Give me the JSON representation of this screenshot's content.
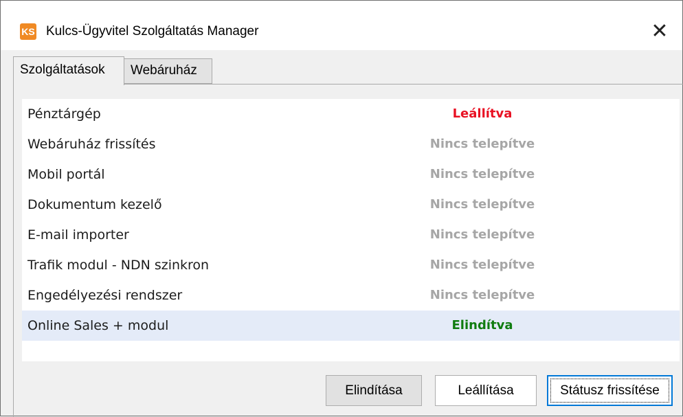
{
  "window": {
    "title": "Kulcs-Ügyvitel Szolgáltatás Manager",
    "icon_text": "KS",
    "close_glyph": "✕"
  },
  "tabs": [
    {
      "label": "Szolgáltatások",
      "active": true
    },
    {
      "label": "Webáruház",
      "active": false
    }
  ],
  "services": [
    {
      "name": "Pénztárgép",
      "status": "Leállítva",
      "status_color": "#e81123"
    },
    {
      "name": "Webáruház frissítés",
      "status": "Nincs telepítve",
      "status_color": "#a6a6a6"
    },
    {
      "name": "Mobil portál",
      "status": "Nincs telepítve",
      "status_color": "#a6a6a6"
    },
    {
      "name": "Dokumentum kezelő",
      "status": "Nincs telepítve",
      "status_color": "#a6a6a6"
    },
    {
      "name": "E-mail importer",
      "status": "Nincs telepítve",
      "status_color": "#a6a6a6"
    },
    {
      "name": "Trafik modul - NDN szinkron",
      "status": "Nincs telepítve",
      "status_color": "#a6a6a6"
    },
    {
      "name": "Engedélyezési rendszer",
      "status": "Nincs telepítve",
      "status_color": "#a6a6a6"
    },
    {
      "name": "Online Sales + modul",
      "status": "Elindítva",
      "status_color": "#107c10",
      "selected": true
    }
  ],
  "buttons": {
    "start": "Elindítása",
    "stop": "Leállítása",
    "refresh": "Státusz frissítése"
  },
  "colors": {
    "app_icon": "#f08a24",
    "selection": "#e4ebf8",
    "focus_border": "#0078d7"
  }
}
